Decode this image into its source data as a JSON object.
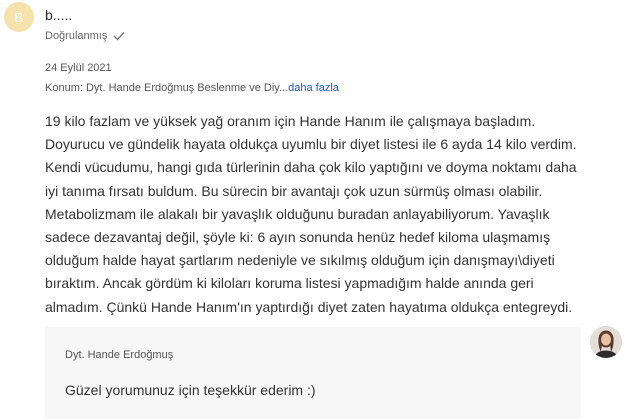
{
  "review": {
    "avatar_initial": "B",
    "reviewer_name": "b.....",
    "verified_label": "Doğrulanmış",
    "date": "24 Eylül 2021",
    "topic_prefix": "Konum: Dyt. Hande Erdoğmuş Beslenme ve Diy...",
    "topic_more": "daha fazla",
    "text_lines": [
      "19 kilo fazlam ve yüksek yağ oranım için Hande Hanım ile çalışmaya başladım.",
      "Doyurucu ve gündelik hayata oldukça uyumlu bir diyet listesi ile 6 ayda 14 kilo verdim.",
      "Kendi vücudumu, hangi gıda türlerinin daha çok kilo yaptığını ve doyma noktamı daha",
      "iyi tanıma fırsatı buldum. Bu sürecin bir avantajı çok uzun sürmüş olması olabilir.",
      "Metabolizmam ile alakalı bir yavaşlık olduğunu buradan anlayabiliyorum. Yavaşlık",
      "sadece dezavantaj değil, şöyle ki: 6 ayın sonunda henüz hedef kiloma ulaşmamış",
      "olduğum halde hayat şartlarım nedeniyle ve sıkılmış olduğum için danışmayı\\diyeti",
      "bıraktım. Ancak gördüm ki kiloları koruma listesi yapmadığım halde anında geri",
      "almadım. Çünkü Hande Hanım'ın yaptırdığı diyet zaten hayatıma oldukça entegreydi."
    ]
  },
  "reply": {
    "author": "Dyt. Hande Erdoğmuş",
    "text": "Güzel yorumunuz için teşekkür ederim :)"
  },
  "icons": {
    "verified": "checkmark-icon",
    "reply_avatar": "doctor-photo"
  },
  "colors": {
    "avatar_bg": "#f6e2ad",
    "link": "#1a56c4",
    "reply_bg": "#f7f7f7"
  }
}
